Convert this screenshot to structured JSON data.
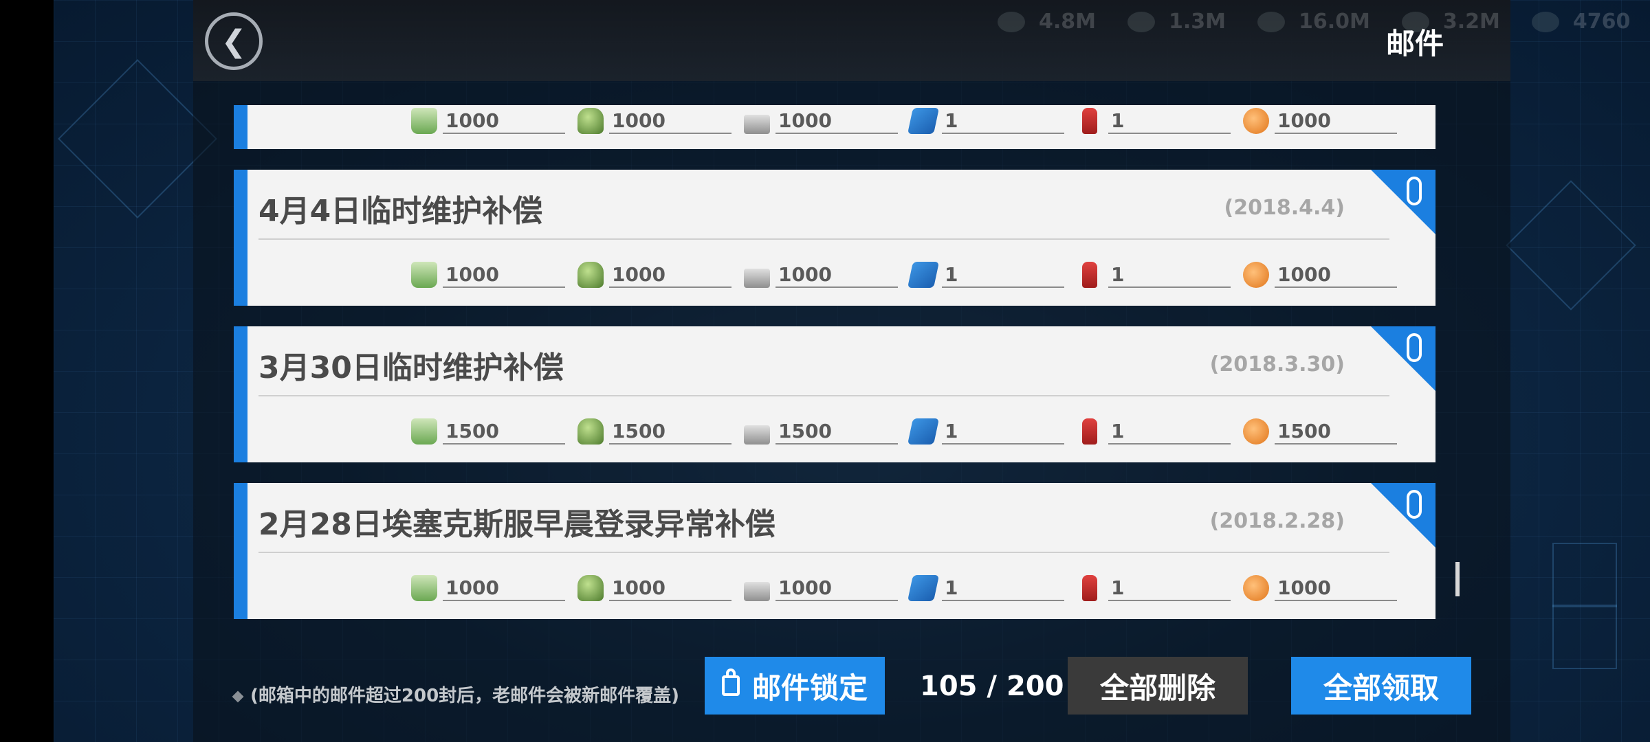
{
  "header": {
    "title": "邮件",
    "back_icon": "chevron-left-icon",
    "resources": [
      "4.8M",
      "1.3M",
      "16.0M",
      "3.2M",
      "4760"
    ]
  },
  "mails": [
    {
      "title": "",
      "date": "",
      "has_attachment": false,
      "rewards": [
        "1000",
        "1000",
        "1000",
        "1",
        "1",
        "1000"
      ]
    },
    {
      "title": "4月4日临时维护补偿",
      "date": "(2018.4.4)",
      "has_attachment": true,
      "rewards": [
        "1000",
        "1000",
        "1000",
        "1",
        "1",
        "1000"
      ]
    },
    {
      "title": "3月30日临时维护补偿",
      "date": "(2018.3.30)",
      "has_attachment": true,
      "rewards": [
        "1500",
        "1500",
        "1500",
        "1",
        "1",
        "1500"
      ]
    },
    {
      "title": "2月28日埃塞克斯服早晨登录异常补偿",
      "date": "(2018.2.28)",
      "has_attachment": true,
      "rewards": [
        "1000",
        "1000",
        "1000",
        "1",
        "1",
        "1000"
      ]
    }
  ],
  "reward_icons": [
    "manpower-icon",
    "ammo-icon",
    "rations-icon",
    "parts-icon",
    "extinguisher-icon",
    "core-icon"
  ],
  "footer": {
    "notice": "(邮箱中的邮件超过200封后，老邮件会被新邮件覆盖)",
    "lock_label": "邮件锁定",
    "count": "105 / 200",
    "delete_label": "全部删除",
    "claim_label": "全部领取"
  },
  "colors": {
    "accent": "#1f8ae9",
    "card_bg": "#f3f3f3",
    "delete_bg": "#3a3a3a"
  }
}
